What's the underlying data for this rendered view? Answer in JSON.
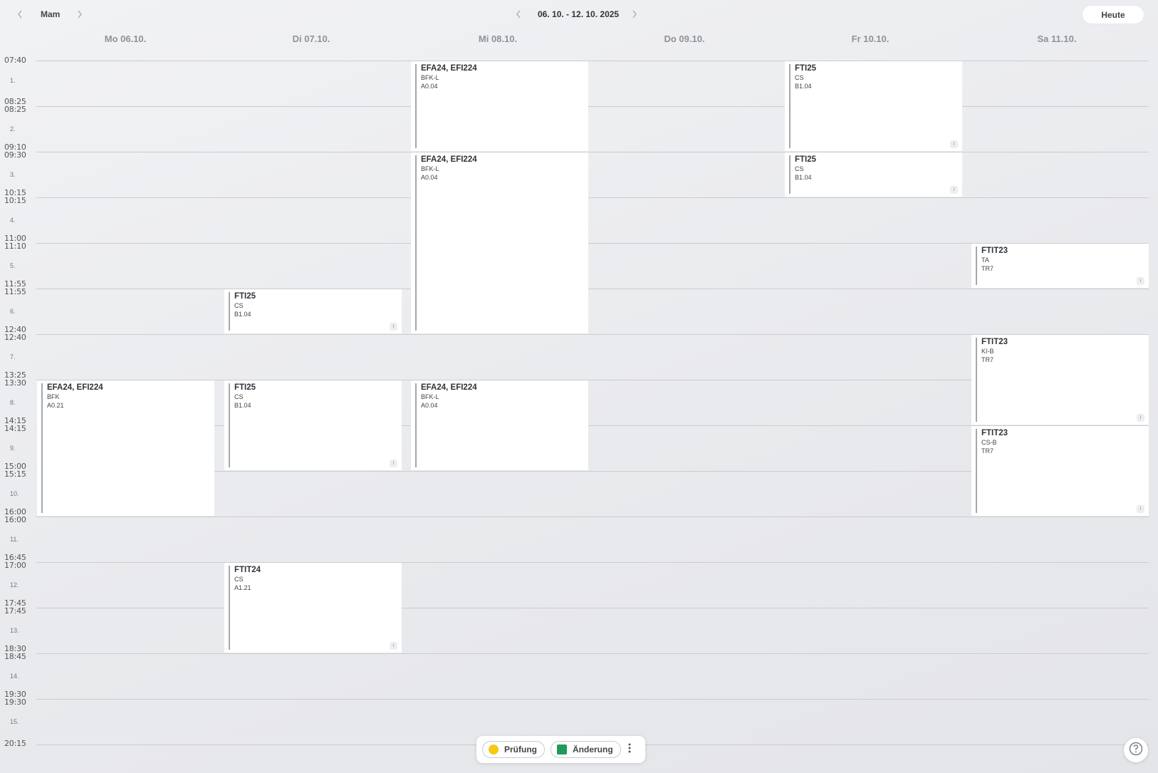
{
  "topbar": {
    "prev_icon": "chevron-left-icon",
    "next_icon": "chevron-right-icon",
    "user": "Mam",
    "date_range": "06. 10. - 12. 10. 2025",
    "today_label": "Heute"
  },
  "days": [
    "Mo 06.10.",
    "Di 07.10.",
    "Mi 08.10.",
    "Do 09.10.",
    "Fr 10.10.",
    "Sa 11.10."
  ],
  "time_labels": [
    "07:40",
    "08:25",
    "08:25",
    "09:10",
    "09:30",
    "10:15",
    "10:15",
    "11:00",
    "11:10",
    "11:55",
    "11:55",
    "12:40",
    "12:40",
    "13:25",
    "13:30",
    "14:15",
    "14:15",
    "15:00",
    "15:15",
    "16:00",
    "16:00",
    "16:45",
    "17:00",
    "17:45",
    "17:45",
    "18:30",
    "18:45",
    "19:30",
    "19:30",
    "20:15"
  ],
  "periods": [
    "1.",
    "2.",
    "3.",
    "4.",
    "5.",
    "6.",
    "7.",
    "8.",
    "9.",
    "10.",
    "11.",
    "12.",
    "13.",
    "14.",
    "15."
  ],
  "events": [
    {
      "title": "EFA24, EFI224",
      "subject": "BFK-L",
      "room": "A0.04",
      "info": false
    },
    {
      "title": "FTI25",
      "subject": "CS",
      "room": "B1.04",
      "info": true
    },
    {
      "title": "EFA24, EFI224",
      "subject": "BFK-L",
      "room": "A0.04",
      "info": false
    },
    {
      "title": "FTI25",
      "subject": "CS",
      "room": "B1.04",
      "info": true
    },
    {
      "title": "FTIT23",
      "subject": "TA",
      "room": "TR7",
      "info": true
    },
    {
      "title": "FTI25",
      "subject": "CS",
      "room": "B1.04",
      "info": true
    },
    {
      "title": "FTIT23",
      "subject": "KI-B",
      "room": "TR7",
      "info": true
    },
    {
      "title": "EFA24, EFI224",
      "subject": "BFK",
      "room": "A0.21",
      "info": false
    },
    {
      "title": "FTI25",
      "subject": "CS",
      "room": "B1.04",
      "info": true
    },
    {
      "title": "EFA24, EFI224",
      "subject": "BFK-L",
      "room": "A0.04",
      "info": false
    },
    {
      "title": "FTIT23",
      "subject": "CS-B",
      "room": "TR7",
      "info": true
    },
    {
      "title": "FTIT24",
      "subject": "CS",
      "room": "A1.21",
      "info": true
    }
  ],
  "info_glyph": "i",
  "legend": {
    "exam_label": "Prüfung",
    "change_label": "Änderung",
    "exam_color": "#f6c915",
    "change_color": "#1f9a5c",
    "more_icon": "kebab-menu-icon"
  },
  "help_icon": "help-circle-icon"
}
